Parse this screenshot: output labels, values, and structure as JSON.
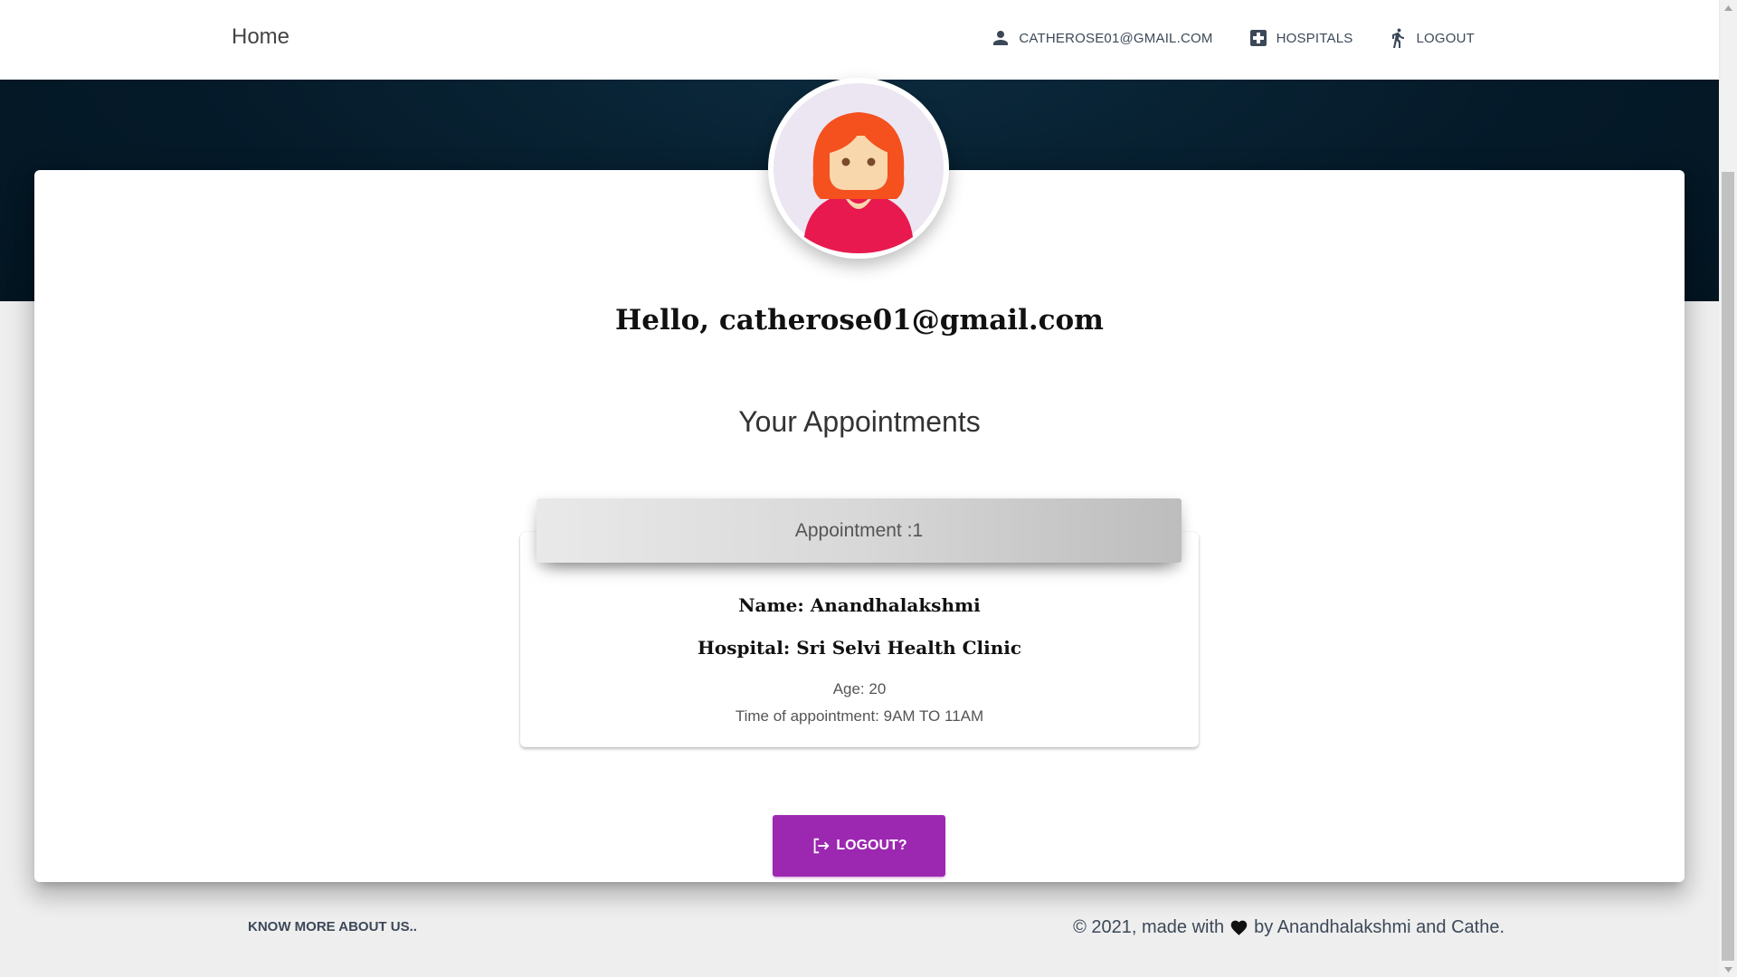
{
  "nav": {
    "brand": "Home",
    "links": [
      {
        "label": "CATHEROSE01@GMAIL.COM",
        "icon": "person-icon"
      },
      {
        "label": "HOSPITALS",
        "icon": "hospital-icon"
      },
      {
        "label": "LOGOUT",
        "icon": "walk-icon"
      }
    ]
  },
  "profile": {
    "greeting": "Hello, catherose01@gmail.com"
  },
  "appointments": {
    "section_title": "Your Appointments",
    "items": [
      {
        "header": "Appointment :1",
        "name": "Name: Anandhalakshmi",
        "hospital": "Hospital: Sri Selvi Health Clinic",
        "age": "Age: 20",
        "time": "Time of appointment: 9AM TO 11AM"
      }
    ]
  },
  "logout_button": {
    "label": "LOGOUT?",
    "icon": "logout-icon"
  },
  "footer": {
    "link": "KNOW MORE ABOUT US..",
    "copyright_prefix": "© 2021, made with",
    "copyright_suffix": "by Anandhalakshmi and Cathe."
  },
  "colors": {
    "accent": "#9c27b0",
    "header_dark": "#051a29",
    "background": "#eeeeee"
  }
}
